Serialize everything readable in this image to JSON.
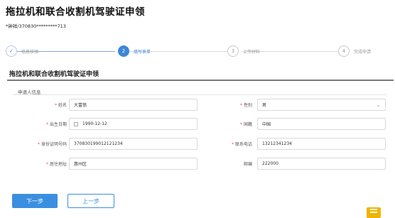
{
  "page": {
    "title": "拖拉机和联合收割机驾驶证申领",
    "user_line": "*钟祥/370830*********713"
  },
  "steps": [
    {
      "num": "✓",
      "label": "信息核验",
      "state": "done"
    },
    {
      "num": "2",
      "label": "填写表单",
      "state": "active"
    },
    {
      "num": "3",
      "label": "上传材料",
      "state": "todo"
    },
    {
      "num": "4",
      "label": "完成申请",
      "state": "todo"
    }
  ],
  "section": {
    "title": "拖拉机和联合收割机驾驶证申领",
    "subtitle": "申请人信息"
  },
  "form": {
    "name": {
      "label": "姓名",
      "value": "大富翁"
    },
    "gender": {
      "label": "性别",
      "value": "男"
    },
    "birth": {
      "label": "出生日期",
      "value": "1990-12-12"
    },
    "nationality": {
      "label": "国籍",
      "value": "中国"
    },
    "id_number": {
      "label": "身份证明号码",
      "value": "370830199012121234"
    },
    "phone": {
      "label": "联系电话",
      "value": "13212341234"
    },
    "address": {
      "label": "居住地址",
      "value": "惠州区"
    },
    "postcode": {
      "label": "邮编",
      "value": "222000"
    }
  },
  "buttons": {
    "next": "下一步",
    "prev": "上一步"
  },
  "colors": {
    "primary": "#3b8fe0",
    "required": "#e05050",
    "corner": "#f0b400"
  },
  "icons": {
    "done_step": "check-icon",
    "date": "calendar-icon",
    "select": "chevron-down-icon",
    "corner": "menu-icon"
  }
}
